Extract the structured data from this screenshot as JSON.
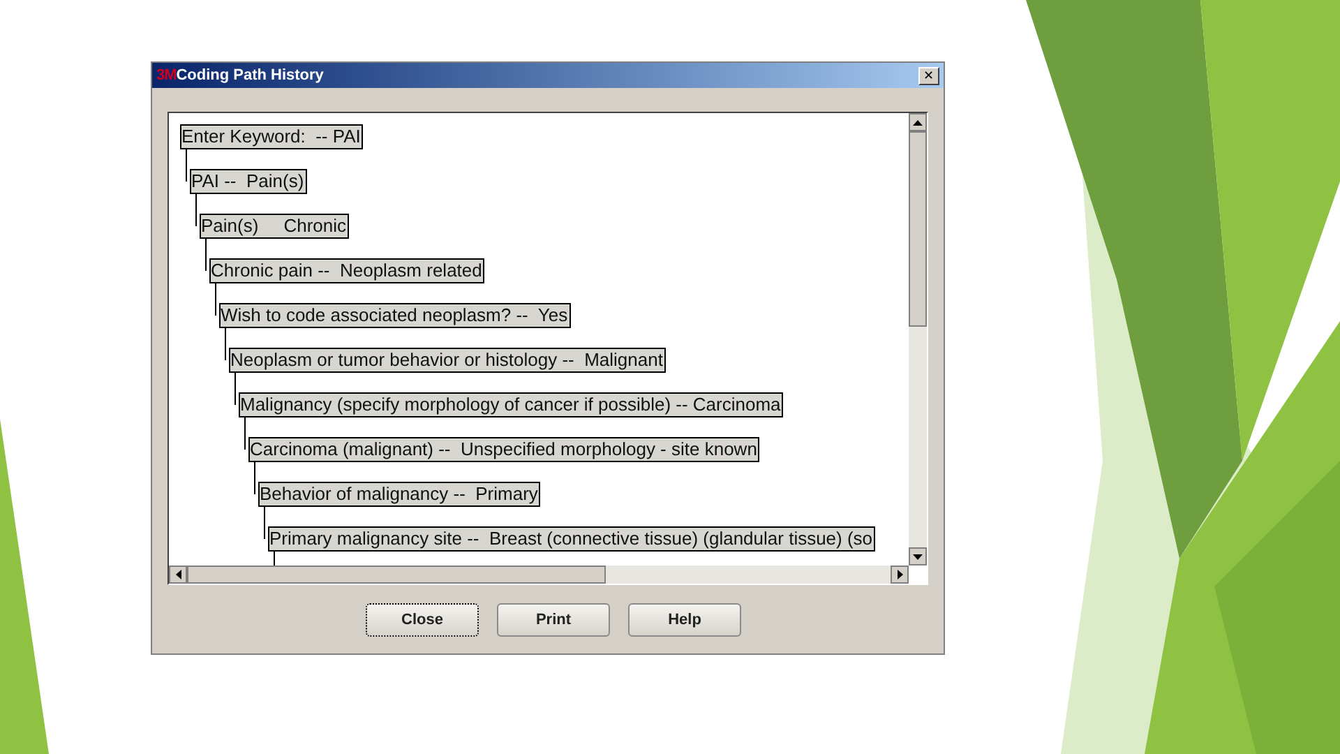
{
  "window": {
    "logo": "3M",
    "title": "Coding Path History",
    "close_glyph": "✕"
  },
  "tree": [
    {
      "label": "Enter Keyword:  -- PAI",
      "children": [
        {
          "label": "PAI --  Pain(s)",
          "children": [
            {
              "label": "Pain(s)     Chronic",
              "children": [
                {
                  "label": "Chronic pain --  Neoplasm related",
                  "children": [
                    {
                      "label": "Wish to code associated neoplasm? --  Yes",
                      "children": [
                        {
                          "label": "Neoplasm or tumor behavior or histology --  Malignant",
                          "children": [
                            {
                              "label": "Malignancy (specify morphology of cancer if possible) -- Carcinoma",
                              "children": [
                                {
                                  "label": "Carcinoma (malignant) --  Unspecified morphology - site known",
                                  "children": [
                                    {
                                      "label": "Behavior of malignancy --  Primary",
                                      "children": [
                                        {
                                          "label": "Primary malignancy site --  Breast (connective tissue) (glandular tissue) (so",
                                          "more_below": true
                                        }
                                      ]
                                    }
                                  ]
                                }
                              ]
                            }
                          ]
                        }
                      ]
                    }
                  ]
                }
              ]
            }
          ]
        }
      ]
    }
  ],
  "buttons": [
    {
      "label": "Close",
      "focused": true
    },
    {
      "label": "Print",
      "focused": false
    },
    {
      "label": "Help",
      "focused": false
    }
  ]
}
